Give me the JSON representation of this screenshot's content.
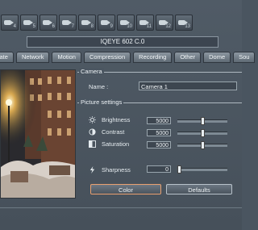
{
  "cameras": [
    {
      "num": "4"
    },
    {
      "num": "5"
    },
    {
      "num": "6"
    },
    {
      "num": "7"
    },
    {
      "num": "8"
    },
    {
      "num": "9"
    },
    {
      "num": "10"
    },
    {
      "num": "11"
    },
    {
      "num": "12"
    },
    {
      "num": "13"
    }
  ],
  "device_title": "IQEYE 602 C.0",
  "tabs": [
    "rate",
    "Network",
    "Motion",
    "Compression",
    "Recording",
    "Other",
    "Dome",
    "Sou"
  ],
  "camera_group": {
    "title": "Camera",
    "name_label": "Name :",
    "name_value": "Camera 1"
  },
  "picture_group": {
    "title": "Picture settings",
    "brightness": {
      "label": "Brightness",
      "value": "5000"
    },
    "contrast": {
      "label": "Contrast",
      "value": "5000"
    },
    "saturation": {
      "label": "Saturation",
      "value": "5000"
    },
    "sharpness": {
      "label": "Sharpness",
      "value": "0"
    }
  },
  "buttons": {
    "color": "Color",
    "defaults": "Defaults"
  },
  "slider_levels": {
    "brightness": 0.5,
    "contrast": 0.5,
    "saturation": 0.5,
    "sharpness": 0.0
  },
  "colors": {
    "accent_border": "#e8a070",
    "panel_bg": "#4b5661"
  }
}
